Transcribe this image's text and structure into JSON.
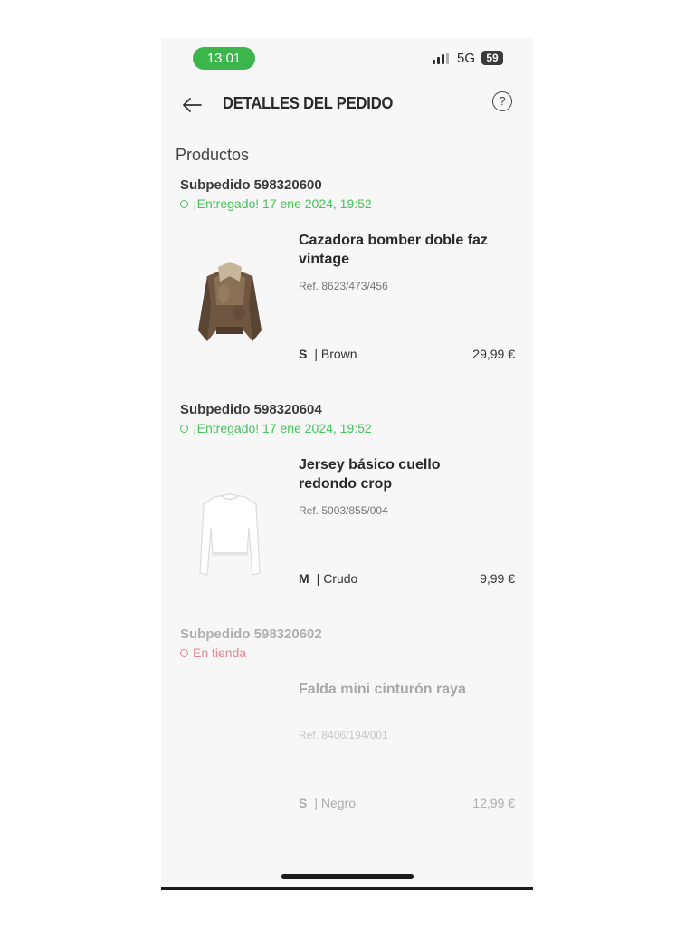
{
  "status_bar": {
    "time": "13:01",
    "network": "5G",
    "battery": "59",
    "time_badge_color": "#3cb54a"
  },
  "header": {
    "title": "DETALLES DEL PEDIDO",
    "back_icon": "arrow-left-icon",
    "help_icon": "question-circle-icon",
    "help_glyph": "?"
  },
  "section_title": "Productos",
  "colors": {
    "delivered": "#46c35a",
    "in_store": "#e8848f"
  },
  "suborders": [
    {
      "id": "Subpedido 598320600",
      "status": "¡Entregado! 17 ene 2024, 19:52",
      "status_type": "delivered",
      "product": {
        "name": "Cazadora bomber doble faz vintage",
        "ref": "Ref. 8623/473/456",
        "size": "S",
        "color": "| Brown",
        "price": "29,99 €",
        "image": "brown-bomber-jacket"
      }
    },
    {
      "id": "Subpedido 598320604",
      "status": "¡Entregado! 17 ene 2024, 19:52",
      "status_type": "delivered",
      "product": {
        "name": "Jersey básico cuello redondo crop",
        "ref": "Ref. 5003/855/004",
        "size": "M",
        "color": "| Crudo",
        "price": "9,99 €",
        "image": "white-crop-sweater"
      }
    },
    {
      "id": "Subpedido 598320602",
      "status": "En tienda",
      "status_type": "in_store",
      "product": {
        "name": "Falda mini cinturón raya",
        "ref": "Ref. 8406/194/001",
        "size": "S",
        "color": "| Negro",
        "price": "12,99 €",
        "image": "none"
      }
    }
  ]
}
